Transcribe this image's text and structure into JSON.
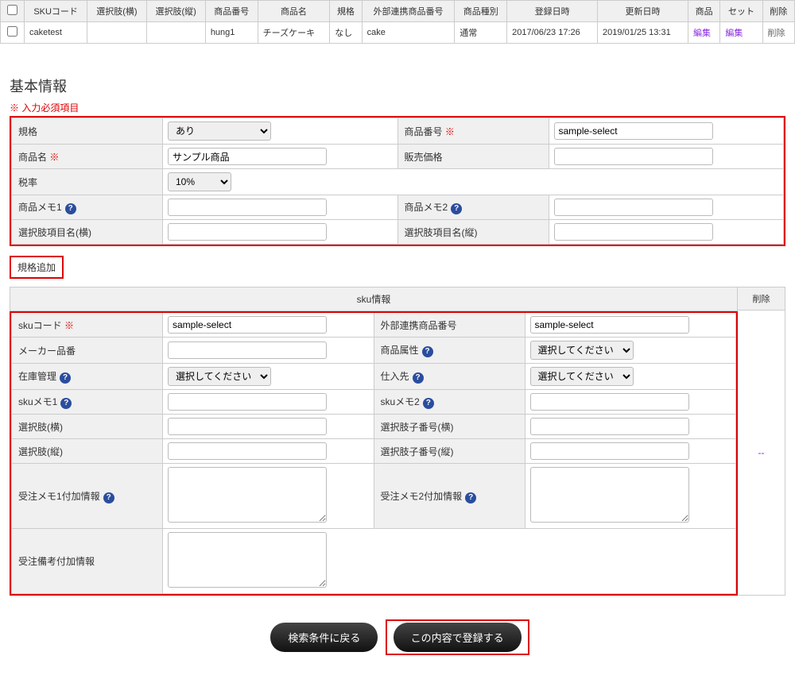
{
  "topTable": {
    "headers": [
      "",
      "SKUコード",
      "選択肢(横)",
      "選択肢(縦)",
      "商品番号",
      "商品名",
      "規格",
      "外部連携商品番号",
      "商品種別",
      "登録日時",
      "更新日時",
      "商品",
      "セット",
      "削除"
    ],
    "row": {
      "sku": "caketest",
      "optH": "",
      "optV": "",
      "prodNo": "hung1",
      "prodName": "チーズケーキ",
      "spec": "なし",
      "extNo": "cake",
      "kind": "通常",
      "created": "2017/06/23 17:26",
      "updated": "2019/01/25 13:31",
      "editProd": "編集",
      "editSet": "編集",
      "del": "削除"
    }
  },
  "sectionTitle": "基本情報",
  "requiredNote": "※ 入力必須項目",
  "req": "※",
  "basic": {
    "spec": {
      "label": "規格",
      "value": "あり"
    },
    "prodNo": {
      "label": "商品番号",
      "value": "sample-select"
    },
    "prodName": {
      "label": "商品名",
      "value": "サンプル商品"
    },
    "price": {
      "label": "販売価格",
      "value": ""
    },
    "tax": {
      "label": "税率",
      "value": "10%"
    },
    "memo1": {
      "label": "商品メモ1",
      "value": ""
    },
    "memo2": {
      "label": "商品メモ2",
      "value": ""
    },
    "optNameH": {
      "label": "選択肢項目名(横)",
      "value": ""
    },
    "optNameV": {
      "label": "選択肢項目名(縦)",
      "value": ""
    }
  },
  "addSpecBtn": "規格追加",
  "skuInfoTitle": "sku情報",
  "deleteColHead": "削除",
  "deleteLink": "--",
  "sku": {
    "code": {
      "label": "skuコード",
      "value": "sample-select"
    },
    "extNo": {
      "label": "外部連携商品番号",
      "value": "sample-select"
    },
    "makerNo": {
      "label": "メーカー品番",
      "value": ""
    },
    "attr": {
      "label": "商品属性",
      "value": "選択してください"
    },
    "stock": {
      "label": "在庫管理",
      "value": "選択してください"
    },
    "supplier": {
      "label": "仕入先",
      "value": "選択してください"
    },
    "memo1": {
      "label": "skuメモ1",
      "value": ""
    },
    "memo2": {
      "label": "skuメモ2",
      "value": ""
    },
    "optH": {
      "label": "選択肢(横)",
      "value": ""
    },
    "optChildH": {
      "label": "選択肢子番号(横)",
      "value": ""
    },
    "optV": {
      "label": "選択肢(縦)",
      "value": ""
    },
    "optChildV": {
      "label": "選択肢子番号(縦)",
      "value": ""
    },
    "orderMemo1": {
      "label": "受注メモ1付加情報",
      "value": ""
    },
    "orderMemo2": {
      "label": "受注メモ2付加情報",
      "value": ""
    },
    "orderNote": {
      "label": "受注備考付加情報",
      "value": ""
    }
  },
  "buttons": {
    "back": "検索条件に戻る",
    "submit": "この内容で登録する"
  },
  "help": "?"
}
